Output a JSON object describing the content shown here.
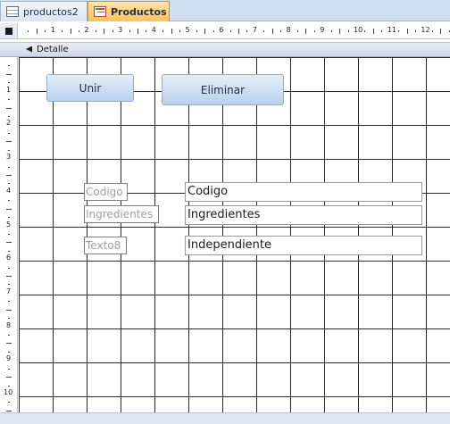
{
  "tabs": [
    {
      "label": "productos2",
      "icon": "table-icon",
      "active": false
    },
    {
      "label": "Productos",
      "icon": "form-icon",
      "active": true
    }
  ],
  "ruler": {
    "horizontal_labels": [
      "1",
      "2",
      "3",
      "4",
      "5",
      "6",
      "7",
      "8",
      "9",
      "10",
      "11",
      "12"
    ],
    "vertical_labels": [
      "1",
      "2",
      "3",
      "4",
      "5",
      "6",
      "7",
      "8",
      "9",
      "10"
    ]
  },
  "section": {
    "label": "Detalle",
    "icon": "section-collapse-icon"
  },
  "buttons": {
    "unir": "Unir",
    "eliminar": "Eliminar"
  },
  "labels": {
    "codigo": "Codigo",
    "ingredientes": "Ingredientes",
    "texto8": "Texto8"
  },
  "fields": {
    "codigo": "Codigo",
    "ingredientes": "Ingredientes",
    "independiente": "Independiente"
  },
  "colors": {
    "active_tab": "#ffc15a",
    "button": "#b9d1ec",
    "grid_line": "#2a2a2a"
  }
}
